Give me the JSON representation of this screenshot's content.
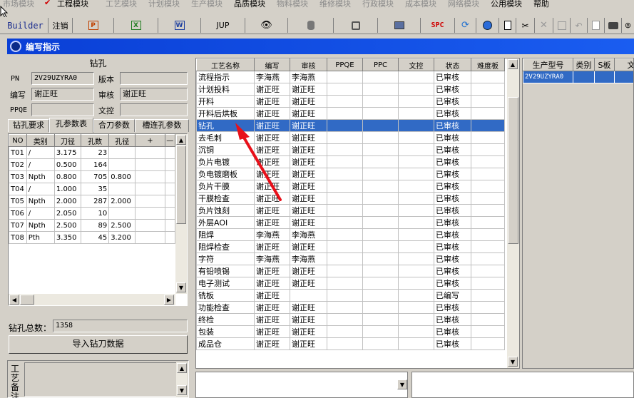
{
  "menu": [
    "市场模块",
    "工程模块",
    "工艺模块",
    "计划模块",
    "生产模块",
    "品质模块",
    "物料模块",
    "维修模块",
    "行政模块",
    "成本模块",
    "网络模块",
    "公用模块",
    "帮助"
  ],
  "toolbar": {
    "builder": "Builder",
    "logout": "注销",
    "jup": "JUP",
    "spc": "SPC"
  },
  "window_title": "编写指示",
  "drill": {
    "section_title": "钻孔",
    "pn_label": "PN",
    "pn_value": "2V29UZYRA0",
    "version_label": "版本",
    "version_value": "",
    "author_label": "编写",
    "author_value": "谢正旺",
    "reviewer_label": "审核",
    "reviewer_value": "谢正旺",
    "ppqe_label": "PPQE",
    "ppqe_value": "",
    "doc_label": "文控",
    "doc_value": "",
    "tabs": [
      "钻孔要求",
      "孔参数表",
      "合刀参数",
      "槽连孔参数"
    ],
    "selected_tab": 1,
    "columns": [
      "NO",
      "类别",
      "刀径",
      "孔数",
      "孔径",
      "+",
      "—"
    ],
    "rows": [
      [
        "T01",
        "/",
        "3.175",
        "23",
        ""
      ],
      [
        "T02",
        "/",
        "0.500",
        "164",
        ""
      ],
      [
        "T03",
        "Npth",
        "0.800",
        "705",
        "0.800"
      ],
      [
        "T04",
        "/",
        "1.000",
        "35",
        ""
      ],
      [
        "T05",
        "Npth",
        "2.000",
        "287",
        "2.000"
      ],
      [
        "T06",
        "/",
        "2.050",
        "10",
        ""
      ],
      [
        "T07",
        "Npth",
        "2.500",
        "89",
        "2.500"
      ],
      [
        "T08",
        "Pth",
        "3.350",
        "45",
        "3.200"
      ]
    ],
    "total_label": "钻孔总数：",
    "total_value": "1358",
    "import_button": "导入钻刀数据",
    "remark_label": "工艺备注"
  },
  "process": {
    "columns": [
      "工艺名称",
      "编写",
      "审核",
      "PPQE",
      "PPC",
      "文控",
      "状态",
      "难度板"
    ],
    "selected_index": 4,
    "rows": [
      [
        "流程指示",
        "李海燕",
        "李海燕",
        "",
        "",
        "",
        "已审核",
        ""
      ],
      [
        "计划投料",
        "谢正旺",
        "谢正旺",
        "",
        "",
        "",
        "已审核",
        ""
      ],
      [
        "开料",
        "谢正旺",
        "谢正旺",
        "",
        "",
        "",
        "已审核",
        ""
      ],
      [
        "开料后烘板",
        "谢正旺",
        "谢正旺",
        "",
        "",
        "",
        "已审核",
        ""
      ],
      [
        "钻孔",
        "谢正旺",
        "谢正旺",
        "",
        "",
        "",
        "已审核",
        ""
      ],
      [
        "去毛刺",
        "谢正旺",
        "谢正旺",
        "",
        "",
        "",
        "已审核",
        ""
      ],
      [
        "沉铜",
        "谢正旺",
        "谢正旺",
        "",
        "",
        "",
        "已审核",
        ""
      ],
      [
        "负片电镀",
        "谢正旺",
        "谢正旺",
        "",
        "",
        "",
        "已审核",
        ""
      ],
      [
        "负电镀磨板",
        "谢正旺",
        "谢正旺",
        "",
        "",
        "",
        "已审核",
        ""
      ],
      [
        "负片干膜",
        "谢正旺",
        "谢正旺",
        "",
        "",
        "",
        "已审核",
        ""
      ],
      [
        "干膜检查",
        "谢正旺",
        "谢正旺",
        "",
        "",
        "",
        "已审核",
        ""
      ],
      [
        "负片蚀刻",
        "谢正旺",
        "谢正旺",
        "",
        "",
        "",
        "已审核",
        ""
      ],
      [
        "外层AOI",
        "谢正旺",
        "谢正旺",
        "",
        "",
        "",
        "已审核",
        ""
      ],
      [
        "阻焊",
        "李海燕",
        "李海燕",
        "",
        "",
        "",
        "已审核",
        ""
      ],
      [
        "阻焊检查",
        "谢正旺",
        "谢正旺",
        "",
        "",
        "",
        "已审核",
        ""
      ],
      [
        "字符",
        "李海燕",
        "李海燕",
        "",
        "",
        "",
        "已审核",
        ""
      ],
      [
        "有铅喷锡",
        "谢正旺",
        "谢正旺",
        "",
        "",
        "",
        "已审核",
        ""
      ],
      [
        "电子测试",
        "谢正旺",
        "谢正旺",
        "",
        "",
        "",
        "已审核",
        ""
      ],
      [
        "铣板",
        "谢正旺",
        "",
        "",
        "",
        "",
        "已编写",
        ""
      ],
      [
        "功能检查",
        "谢正旺",
        "谢正旺",
        "",
        "",
        "",
        "已审核",
        ""
      ],
      [
        "终检",
        "谢正旺",
        "谢正旺",
        "",
        "",
        "",
        "已审核",
        ""
      ],
      [
        "包装",
        "谢正旺",
        "谢正旺",
        "",
        "",
        "",
        "已审核",
        ""
      ],
      [
        "成品仓",
        "谢正旺",
        "谢正旺",
        "",
        "",
        "",
        "已审核",
        ""
      ]
    ]
  },
  "products": {
    "columns": [
      "生产型号",
      "类别",
      "S板",
      "文"
    ],
    "rows": [
      [
        "2V29UZYRA0",
        "",
        "",
        ""
      ]
    ]
  },
  "colors": {
    "selection": "#316ac5",
    "title_bar": "#0a3fd6",
    "annotation_arrow": "#e8101a"
  }
}
